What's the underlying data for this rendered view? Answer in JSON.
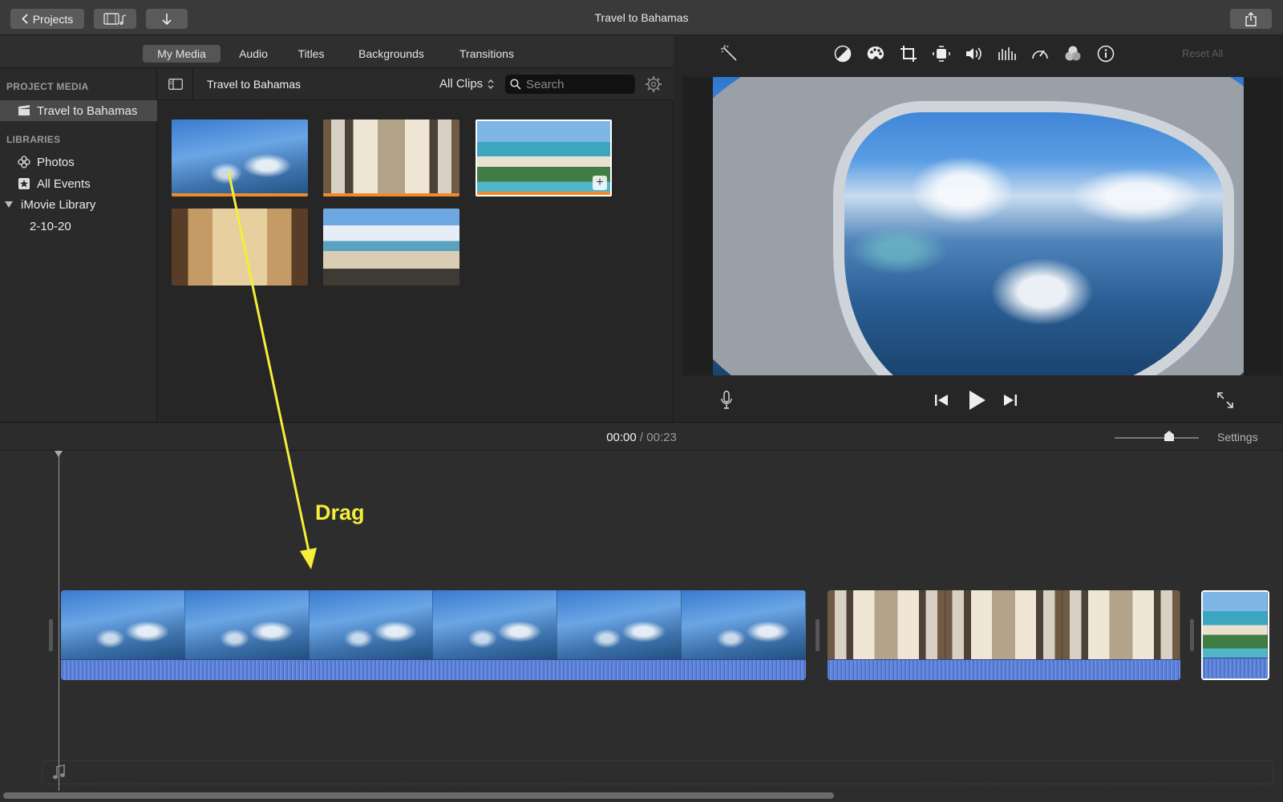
{
  "window": {
    "title": "Travel to Bahamas"
  },
  "toolbar": {
    "projects_label": "Projects",
    "media_icon": "film-music-icon",
    "import_icon": "arrow-down-icon",
    "share_icon": "share-icon"
  },
  "browser": {
    "tabs": [
      {
        "label": "My Media",
        "active": true
      },
      {
        "label": "Audio",
        "active": false
      },
      {
        "label": "Titles",
        "active": false
      },
      {
        "label": "Backgrounds",
        "active": false
      },
      {
        "label": "Transitions",
        "active": false
      }
    ],
    "media_title": "Travel to Bahamas",
    "clips_filter": "All Clips",
    "search_placeholder": "Search"
  },
  "sidebar": {
    "project_media_header": "PROJECT MEDIA",
    "project_item": "Travel to Bahamas",
    "libraries_header": "LIBRARIES",
    "items": [
      {
        "label": "Photos",
        "icon": "photos-icon"
      },
      {
        "label": "All Events",
        "icon": "star-icon"
      },
      {
        "label": "iMovie Library",
        "icon": "disclosure-triangle-icon"
      },
      {
        "label": "2-10-20"
      }
    ]
  },
  "viewer": {
    "reset_all": "Reset All",
    "adjust_icons": [
      "color-balance-icon",
      "color-correction-icon",
      "crop-icon",
      "stabilization-icon",
      "volume-icon",
      "noise-reduction-icon",
      "speed-icon",
      "clip-filter-icon",
      "info-icon"
    ]
  },
  "timeline": {
    "current_time": "00:00",
    "separator": "/",
    "total_time": "00:23",
    "settings_label": "Settings"
  },
  "annotation": {
    "label": "Drag",
    "color": "#f5ee3a"
  }
}
